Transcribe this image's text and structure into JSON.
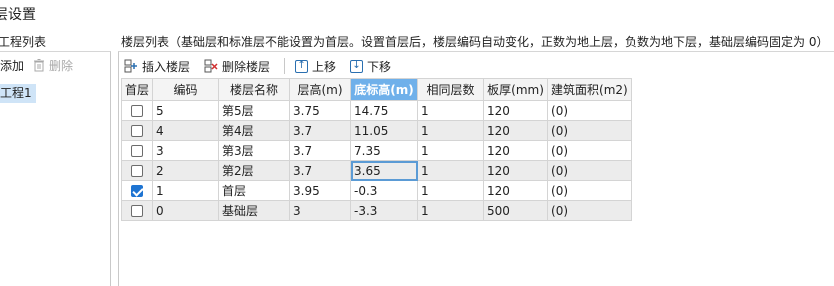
{
  "title": "层设置",
  "left": {
    "label": "工程列表",
    "add_label": "添加",
    "delete_label": "删除",
    "projects": [
      "工程1"
    ]
  },
  "right": {
    "label": "楼层列表（基础层和标准层不能设置为首层。设置首层后，楼层编码自动变化，正数为地上层，负数为地下层，基础层编码固定为 0）",
    "toolbar": {
      "insert": "插入楼层",
      "delete": "删除楼层",
      "up": "上移",
      "down": "下移"
    },
    "columns": [
      "首层",
      "编码",
      "楼层名称",
      "层高(m)",
      "底标高(m)",
      "相同层数",
      "板厚(mm)",
      "建筑面积(m2)"
    ],
    "rows": [
      {
        "first": false,
        "code": "5",
        "name": "第5层",
        "height": "3.75",
        "bottom": "14.75",
        "same": "1",
        "thick": "120",
        "area": "(0)"
      },
      {
        "first": false,
        "code": "4",
        "name": "第4层",
        "height": "3.7",
        "bottom": "11.05",
        "same": "1",
        "thick": "120",
        "area": "(0)"
      },
      {
        "first": false,
        "code": "3",
        "name": "第3层",
        "height": "3.7",
        "bottom": "7.35",
        "same": "1",
        "thick": "120",
        "area": "(0)"
      },
      {
        "first": false,
        "code": "2",
        "name": "第2层",
        "height": "3.7",
        "bottom": "3.65",
        "same": "1",
        "thick": "120",
        "area": "(0)"
      },
      {
        "first": true,
        "code": "1",
        "name": "首层",
        "height": "3.95",
        "bottom": "-0.3",
        "same": "1",
        "thick": "120",
        "area": "(0)"
      },
      {
        "first": false,
        "code": "0",
        "name": "基础层",
        "height": "3",
        "bottom": "-3.3",
        "same": "1",
        "thick": "500",
        "area": "(0)"
      }
    ]
  }
}
